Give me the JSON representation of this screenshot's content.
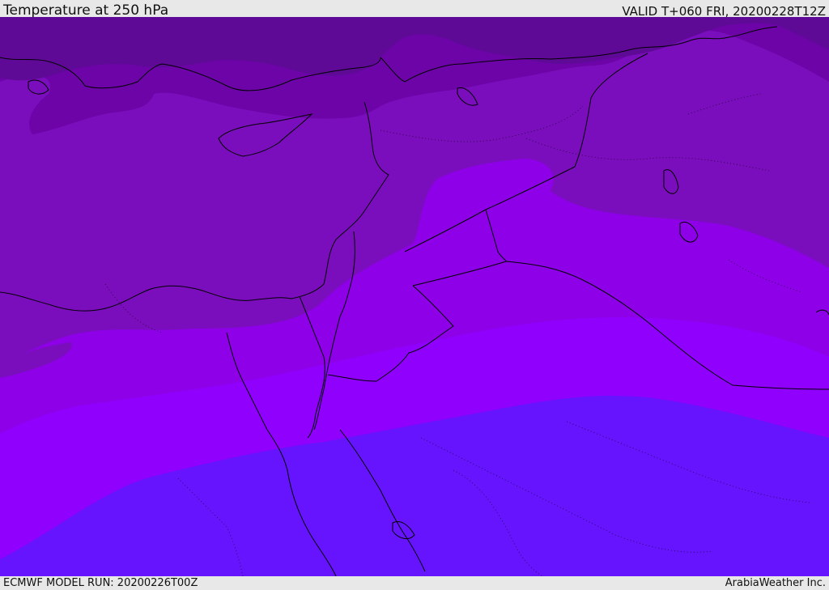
{
  "header": {
    "title": "Temperature at 250 hPa",
    "valid": "VALID T+060 FRI, 20200228T12Z"
  },
  "footer": {
    "model_run": "ECMWF MODEL RUN: 20200226T00Z",
    "credit": "ArabiaWeather Inc."
  },
  "colors": {
    "band_darkest": "#5e0a96",
    "band_dark": "#6c04a8",
    "band_mid": "#7a0ebc",
    "band_violet": "#8d00e8",
    "band_bright": "#8f00fd",
    "band_blue": "#6614fe",
    "coastline": "#000000"
  }
}
